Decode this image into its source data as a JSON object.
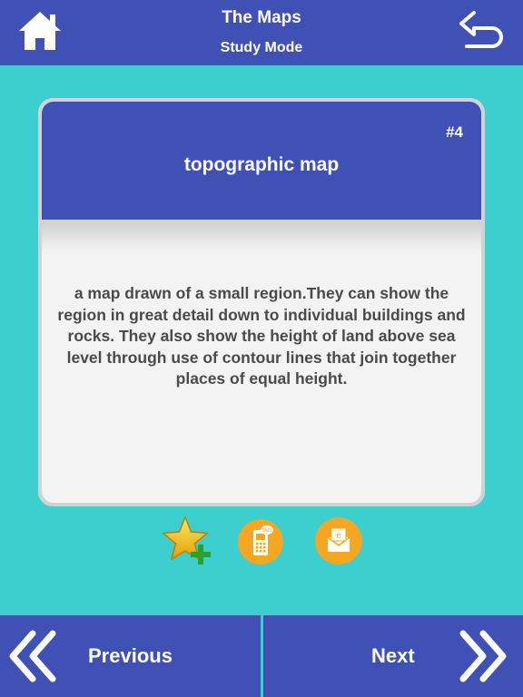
{
  "header": {
    "title": "The Maps",
    "subtitle": "Study Mode",
    "home_icon": "home-icon",
    "back_icon": "undo-arrow-icon"
  },
  "card": {
    "number": "#4",
    "term": "topographic map",
    "definition": "a map drawn of a small region.They can show the region in great detail down to individual buildings and rocks. They also show the height of land above sea level through use of contour lines that join together places of equal height."
  },
  "actions": {
    "favorite_icon": "star-add-icon",
    "sms_icon": "sms-phone-icon",
    "email_icon": "email-icon",
    "sms_badge": "SMS",
    "email_badge": "e"
  },
  "footer": {
    "previous_label": "Previous",
    "next_label": "Next",
    "previous_icon": "double-chevron-left-icon",
    "next_icon": "double-chevron-right-icon"
  },
  "colors": {
    "background": "#3dcfcf",
    "primary": "#3f51b5",
    "accent": "#f5a623",
    "card": "#f3f3f3",
    "text": "#4a4a4a"
  }
}
